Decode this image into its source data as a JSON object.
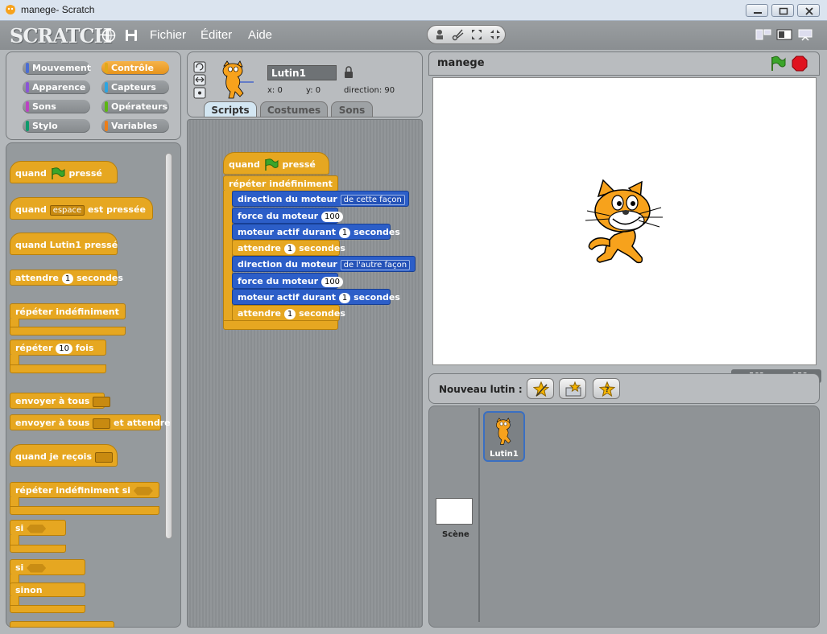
{
  "window": {
    "title": "manege- Scratch"
  },
  "menu": {
    "logo": "SCRATCH",
    "file": "Fichier",
    "edit": "Éditer",
    "help": "Aide"
  },
  "categories": [
    {
      "label": "Mouvement",
      "color": "#4a6cd4"
    },
    {
      "label": "Contrôle",
      "color": "#e1a91a",
      "selected": true
    },
    {
      "label": "Apparence",
      "color": "#8a55d7"
    },
    {
      "label": "Capteurs",
      "color": "#2ca5e2"
    },
    {
      "label": "Sons",
      "color": "#bb42c3"
    },
    {
      "label": "Opérateurs",
      "color": "#5cb712"
    },
    {
      "label": "Stylo",
      "color": "#0e9a6c"
    },
    {
      "label": "Variables",
      "color": "#ee7d16"
    }
  ],
  "palette": {
    "b1": {
      "pre": "quand",
      "post": "pressé"
    },
    "b2": {
      "pre": "quand",
      "dd": "espace",
      "post": "est pressée"
    },
    "b3": {
      "text": "quand Lutin1 pressé"
    },
    "b4": {
      "pre": "attendre",
      "num": "1",
      "post": "secondes"
    },
    "b5": {
      "text": "répéter indéfiniment"
    },
    "b6": {
      "pre": "répéter",
      "num": "10",
      "post": "fois"
    },
    "b7": {
      "text": "envoyer à tous"
    },
    "b8": {
      "pre": "envoyer à tous",
      "post": "et attendre"
    },
    "b9": {
      "text": "quand je reçois"
    },
    "b10": {
      "text": "répéter indéfiniment si"
    },
    "b11": {
      "text": "si"
    },
    "b12": {
      "text": "si",
      "else": "sinon"
    }
  },
  "sprite": {
    "name": "Lutin1",
    "x": "x: 0",
    "y": "y: 0",
    "direction": "direction: 90"
  },
  "tabs": {
    "scripts": "Scripts",
    "costumes": "Costumes",
    "sounds": "Sons"
  },
  "script": {
    "hat": {
      "pre": "quand",
      "post": "pressé"
    },
    "forever": "répéter indéfiniment",
    "rows": {
      "r1": {
        "label": "direction du moteur",
        "dd": "de cette façon"
      },
      "r2": {
        "label": "force du moteur",
        "num": "100"
      },
      "r3": {
        "label": "moteur actif durant",
        "num": "1",
        "post": "secondes"
      },
      "r4": {
        "label": "attendre",
        "num": "1",
        "post": "secondes"
      },
      "r5": {
        "label": "direction du moteur",
        "dd": "de l'autre façon"
      },
      "r6": {
        "label": "force du moteur",
        "num": "100"
      },
      "r7": {
        "label": "moteur actif durant",
        "num": "1",
        "post": "secondes"
      },
      "r8": {
        "label": "attendre",
        "num": "1",
        "post": "secondes"
      }
    }
  },
  "stage": {
    "title": "manege",
    "mouse_x": "x: -563",
    "mouse_y": "y: 158"
  },
  "sprites_bar": {
    "label": "Nouveau lutin :"
  },
  "sprite_list": {
    "sprite_name": "Lutin1",
    "stage_label": "Scène"
  }
}
